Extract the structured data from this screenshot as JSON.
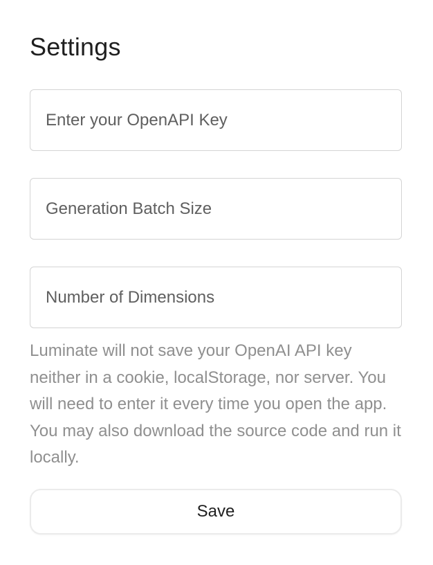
{
  "settings": {
    "title": "Settings",
    "api_key_placeholder": "Enter your OpenAPI Key",
    "batch_size_placeholder": "Generation Batch Size",
    "dimensions_placeholder": "Number of Dimensions",
    "note": "Luminate will not save your OpenAI API key neither in a cookie, localStorage, nor server. You will need to enter it every time you open the app. You may also download the source code and run it locally.",
    "save_label": "Save"
  },
  "colors": {
    "title": "#1f1f1f",
    "field_border": "#d4d4d4",
    "placeholder": "#5f5f5f",
    "note_text": "#8f8f8f",
    "button_border": "#ebebeb"
  }
}
